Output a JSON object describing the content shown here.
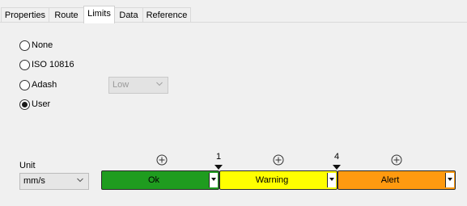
{
  "tabs": [
    {
      "label": "Properties",
      "active": false
    },
    {
      "label": "Route",
      "active": false
    },
    {
      "label": "Limits",
      "active": true
    },
    {
      "label": "Data",
      "active": false
    },
    {
      "label": "Reference",
      "active": false
    }
  ],
  "limit_type": {
    "options": [
      {
        "label": "None",
        "checked": false
      },
      {
        "label": "ISO 10816",
        "checked": false
      },
      {
        "label": "Adash",
        "checked": false
      },
      {
        "label": "User",
        "checked": true
      }
    ],
    "adash_level": {
      "value": "Low",
      "disabled": true
    }
  },
  "unit": {
    "label": "Unit",
    "value": "mm/s"
  },
  "bands": [
    {
      "label": "Ok",
      "color": "#1f9c1f"
    },
    {
      "label": "Warning",
      "color": "#ffff00"
    },
    {
      "label": "Alert",
      "color": "#ff9a10"
    }
  ],
  "thresholds": [
    "1",
    "4"
  ],
  "icons": {
    "add": "add-circle-icon",
    "dropdown": "chevron-down-icon",
    "marker": "triangle-down-icon"
  }
}
